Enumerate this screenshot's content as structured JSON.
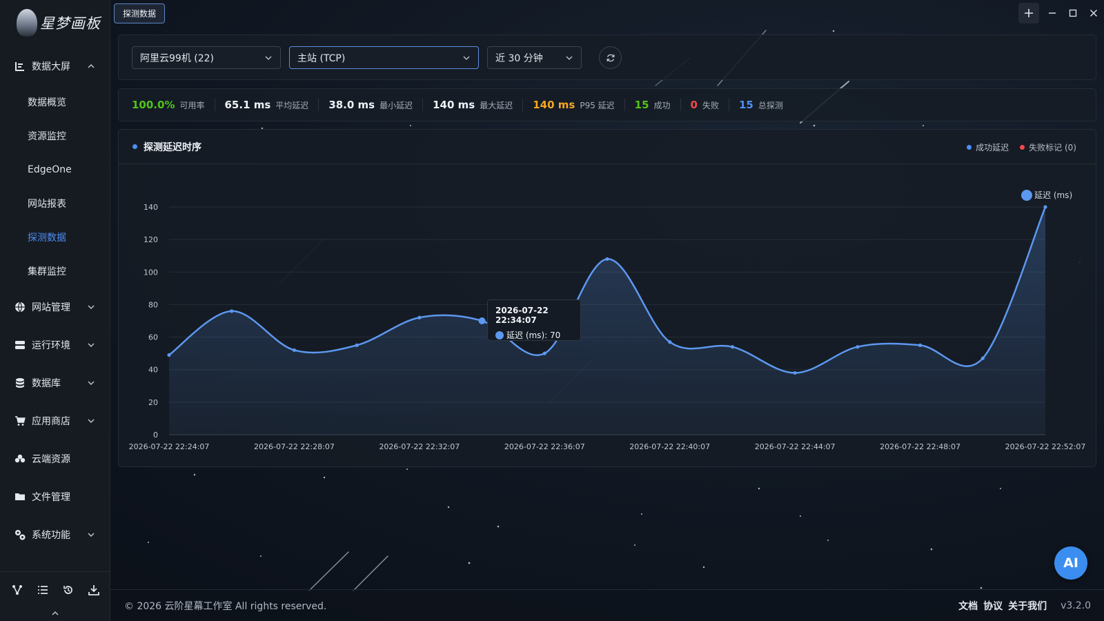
{
  "app": {
    "logo_text": "星梦画板",
    "tab_label": "探测数据"
  },
  "sidebar": {
    "groups": [
      {
        "label": "数据大屏",
        "icon": "bar-chart-icon",
        "expanded": true
      },
      {
        "label": "网站管理",
        "icon": "globe-icon"
      },
      {
        "label": "运行环境",
        "icon": "server-icon"
      },
      {
        "label": "数据库",
        "icon": "database-icon"
      },
      {
        "label": "应用商店",
        "icon": "cart-icon"
      },
      {
        "label": "云端资源",
        "icon": "cloud-icon"
      },
      {
        "label": "文件管理",
        "icon": "folder-icon"
      },
      {
        "label": "系统功能",
        "icon": "gears-icon"
      }
    ],
    "sub_items": [
      {
        "label": "数据概览"
      },
      {
        "label": "资源监控"
      },
      {
        "label": "EdgeOne"
      },
      {
        "label": "网站报表"
      },
      {
        "label": "探测数据",
        "active": true
      },
      {
        "label": "集群监控"
      }
    ]
  },
  "filters": {
    "server": "阿里云99机 (22)",
    "target": "主站 (TCP)",
    "range": "近 30 分钟"
  },
  "stats": [
    {
      "value": "100.0%",
      "label": "可用率",
      "color": "#52c41a"
    },
    {
      "value": "65.1 ms",
      "label": "平均延迟",
      "color": "#eef2f7"
    },
    {
      "value": "38.0 ms",
      "label": "最小延迟",
      "color": "#eef2f7"
    },
    {
      "value": "140 ms",
      "label": "最大延迟",
      "color": "#eef2f7"
    },
    {
      "value": "140 ms",
      "label": "P95 延迟",
      "color": "#f5a623"
    },
    {
      "value": "15",
      "label": "成功",
      "color": "#52c41a"
    },
    {
      "value": "0",
      "label": "失败",
      "color": "#f5484b"
    },
    {
      "value": "15",
      "label": "总探测",
      "color": "#4e8df5"
    }
  ],
  "chart_card": {
    "title": "探测延迟时序",
    "legend_success": "成功延迟",
    "legend_fail": "失败标记 (0)"
  },
  "tooltip": {
    "title": "2026-07-22 22:34:07",
    "row": "延迟 (ms): 70"
  },
  "chart_data": {
    "type": "area",
    "title": "探测延迟时序",
    "x_tick_labels": [
      "2026-07-22 22:24:07",
      "2026-07-22 22:28:07",
      "2026-07-22 22:32:07",
      "2026-07-22 22:36:07",
      "2026-07-22 22:40:07",
      "2026-07-22 22:44:07",
      "2026-07-22 22:48:07",
      "2026-07-22 22:52:07"
    ],
    "x": [
      "2026-07-22 22:24:07",
      "2026-07-22 22:26:07",
      "2026-07-22 22:28:07",
      "2026-07-22 22:30:07",
      "2026-07-22 22:32:07",
      "2026-07-22 22:34:07",
      "2026-07-22 22:36:07",
      "2026-07-22 22:38:07",
      "2026-07-22 22:40:07",
      "2026-07-22 22:42:07",
      "2026-07-22 22:44:07",
      "2026-07-22 22:46:07",
      "2026-07-22 22:48:07",
      "2026-07-22 22:50:07",
      "2026-07-22 22:52:07"
    ],
    "series": [
      {
        "name": "延迟 (ms)",
        "color": "#5d98f0",
        "values": [
          49,
          76,
          52,
          55,
          72,
          70,
          50,
          108,
          57,
          54,
          38,
          54,
          55,
          47,
          140
        ]
      }
    ],
    "ylim": [
      0,
      140
    ],
    "y_ticks": [
      0,
      20,
      40,
      60,
      80,
      100,
      120,
      140
    ],
    "grid": true,
    "legend": "top-right",
    "highlight_index": 5
  },
  "footer": {
    "copyright": "© 2026 云阶星幕工作室 All rights reserved.",
    "links": [
      "文档",
      "协议",
      "关于我们"
    ],
    "version": "v3.2.0"
  },
  "ai_button": "AI"
}
